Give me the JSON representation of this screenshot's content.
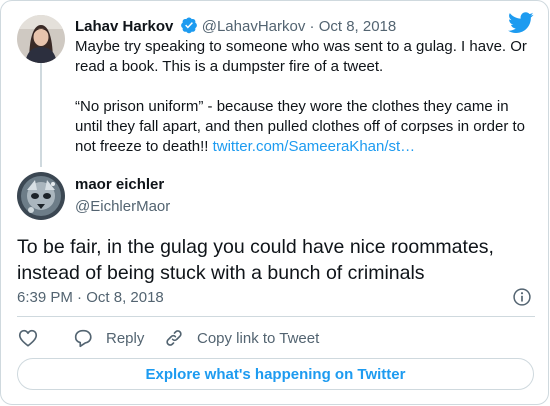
{
  "quoted_tweet": {
    "display_name": "Lahav Harkov",
    "handle": "@LahavHarkov",
    "separator": "·",
    "date": "Oct 8, 2018",
    "paragraph_1": "Maybe try speaking to someone who was sent to a gulag. I have. Or read a book. This is a dumpster fire of a tweet.",
    "paragraph_2_text": "“No prison uniform” - because they wore the clothes they came in until they fall apart, and then pulled clothes off of corpses in order to not freeze to death!! ",
    "paragraph_2_link": "twitter.com/SameeraKhan/st…"
  },
  "tweet": {
    "display_name": "maor eichler",
    "handle": "@EichlerMaor",
    "text": "To be fair, in the gulag you could have nice roommates, instead of being stuck with a bunch of criminals",
    "time": "6:39 PM",
    "separator": "·",
    "date": "Oct 8, 2018"
  },
  "actions": {
    "reply_label": "Reply",
    "copy_link_label": "Copy link to Tweet"
  },
  "footer": {
    "explore_label": "Explore what's happening on Twitter"
  },
  "icons": {
    "brand": "twitter-bird-icon",
    "verified": "verified-badge-icon",
    "info": "info-icon",
    "like": "heart-icon",
    "reply": "reply-bubble-icon",
    "copy_link": "link-icon"
  },
  "colors": {
    "accent": "#1d9bf0",
    "text": "#0f1419",
    "secondary": "#536471",
    "border": "#cfd9de"
  }
}
